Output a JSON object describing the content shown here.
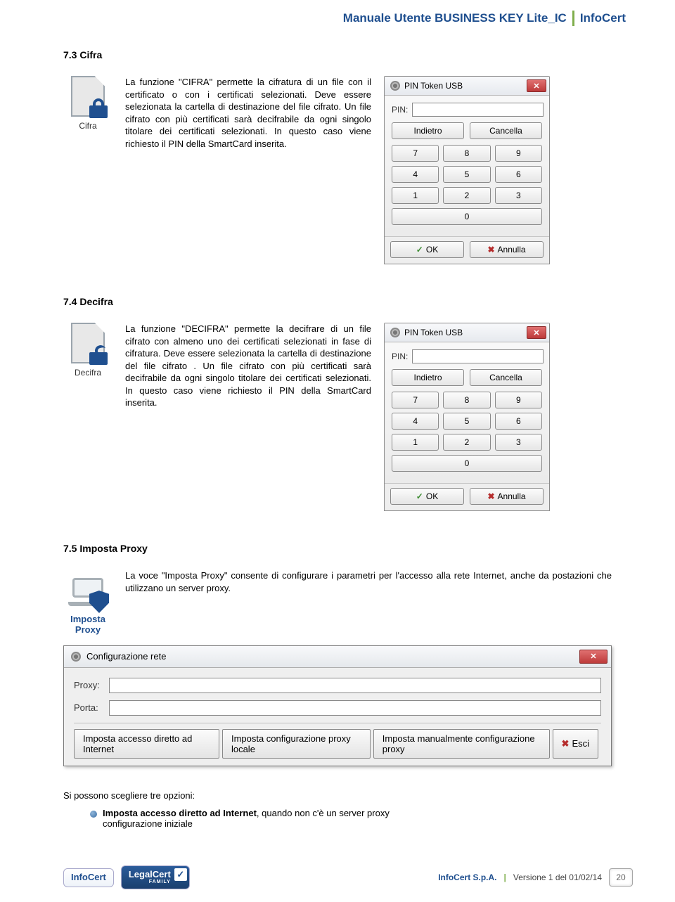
{
  "header": {
    "title": "Manuale Utente BUSINESS KEY Lite_IC",
    "brand": "InfoCert"
  },
  "sections": {
    "cifra": {
      "heading": "7.3 Cifra",
      "icon_label": "Cifra",
      "text": "La funzione \"CIFRA\" permette la cifratura di un file con il certificato o con i certificati selezionati. Deve essere selezionata la cartella di destinazione del file cifrato. Un file cifrato con più certificati sarà decifrabile da ogni singolo titolare dei certificati selezionati. In questo caso viene richiesto il PIN della SmartCard inserita."
    },
    "decifra": {
      "heading": "7.4 Decifra",
      "icon_label": "Decifra",
      "text": "La funzione \"DECIFRA\" permette la decifrare di un file cifrato con almeno uno dei certificati selezionati in fase di cifratura. Deve essere selezionata la cartella di destinazione del file cifrato . Un file cifrato con più certificati sarà decifrabile da ogni singolo titolare dei certificati selezionati. In questo caso viene richiesto il PIN della SmartCard inserita."
    },
    "proxy": {
      "heading": "7.5 Imposta Proxy",
      "icon_label": "Imposta Proxy",
      "text": "La voce \"Imposta Proxy\" consente di configurare i parametri per l'accesso alla rete Internet, anche da postazioni che utilizzano un server proxy.",
      "options_intro": "Si possono scegliere tre opzioni:",
      "option1_bold": "Imposta accesso diretto ad Internet",
      "option1_rest": ", quando non c'è un server proxy",
      "option1_line2": "configurazione  iniziale"
    }
  },
  "pin_dialog": {
    "title": "PIN Token USB",
    "pin_label": "PIN:",
    "back": "Indietro",
    "cancel": "Cancella",
    "keys": [
      "7",
      "8",
      "9",
      "4",
      "5",
      "6",
      "1",
      "2",
      "3",
      "0"
    ],
    "ok": "OK",
    "annulla": "Annulla"
  },
  "config_dialog": {
    "title": "Configurazione rete",
    "proxy_label": "Proxy:",
    "port_label": "Porta:",
    "btn1": "Imposta accesso diretto ad Internet",
    "btn2": "Imposta configurazione proxy locale",
    "btn3": "Imposta manualmente configurazione proxy",
    "exit": "Esci"
  },
  "footer": {
    "infocert": "InfoCert",
    "legalcert": "LegalCert",
    "family": "FAMILY",
    "company": "InfoCert S.p.A.",
    "sep": "|",
    "version": "Versione 1 del 01/02/14",
    "page": "20"
  }
}
